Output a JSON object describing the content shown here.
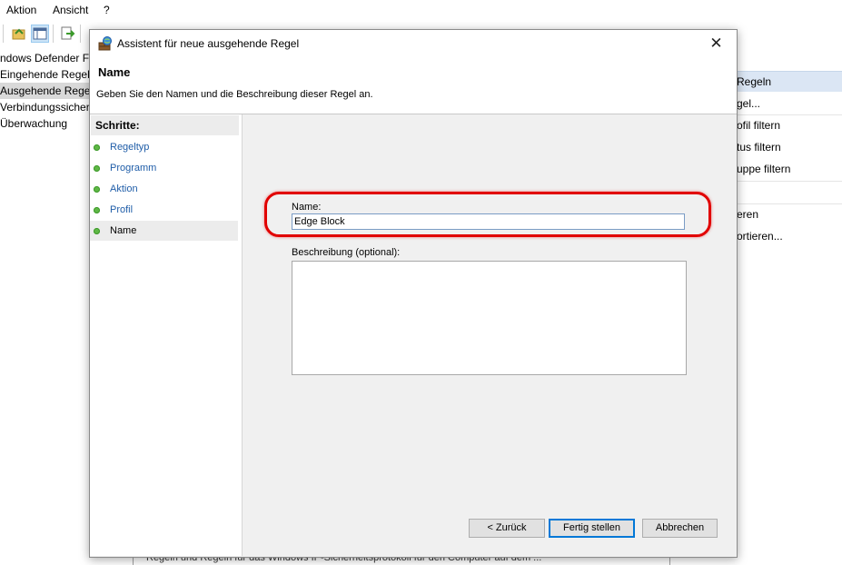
{
  "app": {
    "menu": [
      "Aktion",
      "Ansicht",
      "?"
    ],
    "tree": [
      {
        "label": "ndows Defender Fire",
        "selected": false
      },
      {
        "label": "Eingehende Regeln",
        "selected": false
      },
      {
        "label": "Ausgehende Regeln",
        "selected": true
      },
      {
        "label": "Verbindungssicherh",
        "selected": false
      },
      {
        "label": "Überwachung",
        "selected": false
      }
    ],
    "actions": {
      "header": "Regeln",
      "items": [
        "gel...",
        "ofil filtern",
        "tus filtern",
        "uppe filtern",
        "eren",
        "ortieren..."
      ]
    },
    "bottom_text": "Regeln und Regeln für das Windows IP-Sicherheitsprotokoll für den Computer auf dem ..."
  },
  "dialog": {
    "title": "Assistent für neue ausgehende Regel",
    "heading": "Name",
    "subtitle": "Geben Sie den Namen und die Beschreibung dieser Regel an.",
    "steps_heading": "Schritte:",
    "steps": [
      {
        "label": "Regeltyp",
        "state": "done"
      },
      {
        "label": "Programm",
        "state": "done"
      },
      {
        "label": "Aktion",
        "state": "done"
      },
      {
        "label": "Profil",
        "state": "done"
      },
      {
        "label": "Name",
        "state": "active"
      }
    ],
    "name_label": "Name:",
    "name_value": "Edge Block",
    "description_label": "Beschreibung (optional):",
    "description_value": "",
    "buttons": {
      "back": "< Zurück",
      "finish": "Fertig stellen",
      "cancel": "Abbrechen"
    },
    "close_glyph": "✕"
  },
  "colors": {
    "highlight": "#e10000",
    "step_dot": "#5fb846",
    "link": "#1f5da8",
    "accent": "#0078d7"
  }
}
